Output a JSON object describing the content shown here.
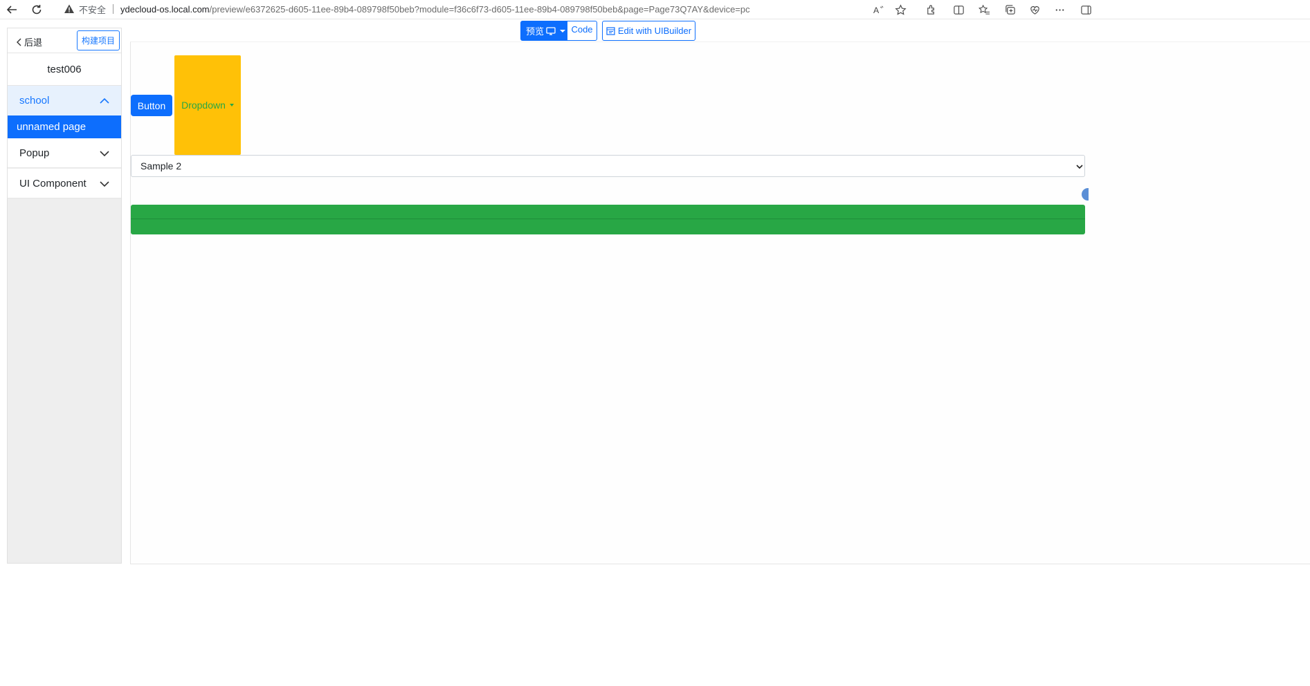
{
  "browser": {
    "insecure_label": "不安全",
    "url_host": "ydecloud-os.local.com",
    "url_path": "/preview/e6372625-d605-11ee-89b4-089798f50beb?module=f36c6f73-d605-11ee-89b4-089798f50beb&page=Page73Q7AY&device=pc"
  },
  "sidebar": {
    "back_label": "后退",
    "build_label": "构建项目",
    "project_name": "test006",
    "groups": [
      {
        "label": "school",
        "expanded": true
      },
      {
        "label": "Popup",
        "expanded": false
      },
      {
        "label": "UI Component",
        "expanded": false
      }
    ],
    "active_page": "unnamed page"
  },
  "toolbar": {
    "preview_label": "预览",
    "code_label": "Code",
    "uibuilder_label": "Edit with UIBuilder"
  },
  "canvas": {
    "button_label": "Button",
    "dropdown_label": "Dropdown",
    "select_value": "Sample 2"
  },
  "colors": {
    "primary": "#0d6efd",
    "warning": "#ffc107",
    "success": "#28a745"
  }
}
